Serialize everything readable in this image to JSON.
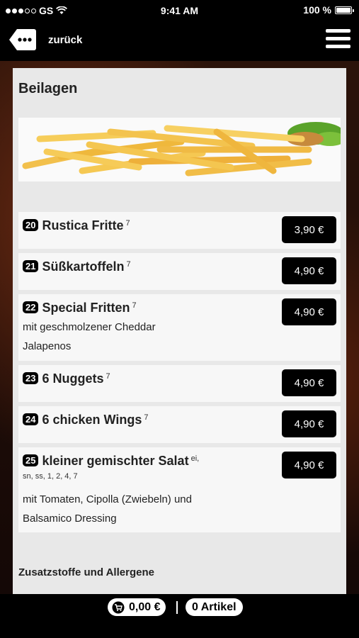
{
  "status_bar": {
    "carrier": "GS",
    "time": "9:41 AM",
    "battery": "100 %",
    "signal_icon": "signal-dots-icon",
    "wifi_icon": "wifi-icon",
    "battery_icon": "battery-icon"
  },
  "nav": {
    "back_label": "zurück",
    "back_icon": "back-tag-icon",
    "menu_icon": "hamburger-menu-icon"
  },
  "page": {
    "title": "Beilagen",
    "banner_icon": "fries-image"
  },
  "items": [
    {
      "number": "20",
      "name": "Rustica Fritte",
      "allergens": "7",
      "price": "3,90 €",
      "description_lines": []
    },
    {
      "number": "21",
      "name": "Süßkartoffeln",
      "allergens": "7",
      "price": "4,90 €",
      "description_lines": []
    },
    {
      "number": "22",
      "name": "Special Fritten",
      "allergens": "7",
      "price": "4,90 €",
      "description_lines": [
        "mit geschmolzener Cheddar",
        "Jalapenos"
      ]
    },
    {
      "number": "23",
      "name": "6 Nuggets",
      "allergens": "7",
      "price": "4,90 €",
      "description_lines": []
    },
    {
      "number": "24",
      "name": "6 chicken Wings",
      "allergens": "7",
      "price": "4,90 €",
      "description_lines": []
    },
    {
      "number": "25",
      "name": "kleiner gemischter Salat",
      "allergens": "ei,",
      "allergens_line2": "sn, ss, 1, 2, 4, 7",
      "price": "4,90 €",
      "description_lines": [
        "mit Tomaten, Cipolla (Zwiebeln) und",
        "Balsamico Dressing"
      ]
    }
  ],
  "footer_link": "Zusatzstoffe und Allergene",
  "bottom_bar": {
    "cart_total": "0,00 €",
    "cart_icon": "shopping-cart-icon",
    "article_count": "0 Artikel"
  }
}
